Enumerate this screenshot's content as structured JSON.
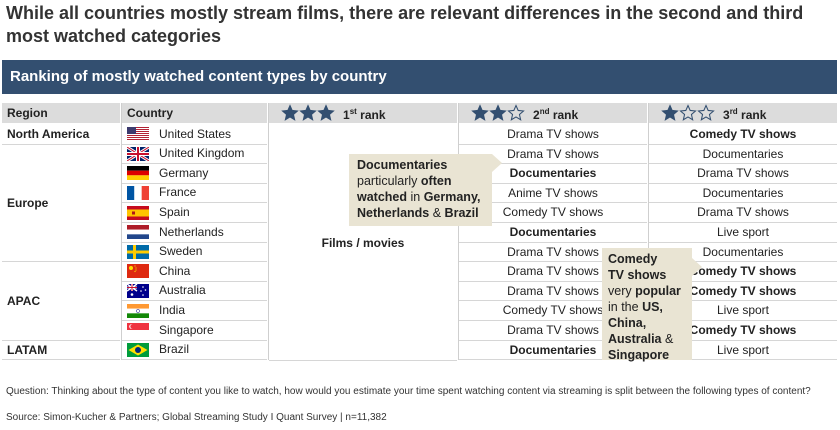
{
  "headline": "While all countries mostly stream films, there are relevant differences in the second and third most watched categories",
  "banner": "Ranking of mostly watched content types by country",
  "headers": {
    "region": "Region",
    "country": "Country",
    "rank1": "1",
    "rank1_suffix": "st",
    "rank2": "2",
    "rank2_suffix": "nd",
    "rank3": "3",
    "rank3_suffix": "rd",
    "rank_word": "rank"
  },
  "colors": {
    "banner": "#334f70",
    "star": "#334f70",
    "callout": "#e9e4d3",
    "header_bg": "#dcdcdc"
  },
  "chart_data": {
    "type": "table",
    "title": "Ranking of mostly watched content types by country",
    "first_rank_all": "Films / movies",
    "regions": [
      {
        "name": "North America",
        "countries": [
          "United States"
        ]
      },
      {
        "name": "Europe",
        "countries": [
          "United Kingdom",
          "Germany",
          "France",
          "Spain",
          "Netherlands",
          "Sweden"
        ]
      },
      {
        "name": "APAC",
        "countries": [
          "China",
          "Australia",
          "India",
          "Singapore"
        ]
      },
      {
        "name": "LATAM",
        "countries": [
          "Brazil"
        ]
      }
    ],
    "rows": [
      {
        "country": "United States",
        "flag": "us",
        "rank2": "Drama TV shows",
        "rank3": "Comedy TV shows",
        "bold2": false,
        "bold3": true
      },
      {
        "country": "United Kingdom",
        "flag": "uk",
        "rank2": "Drama TV shows",
        "rank3": "Documentaries",
        "bold2": false,
        "bold3": false
      },
      {
        "country": "Germany",
        "flag": "de",
        "rank2": "Documentaries",
        "rank3": "Drama TV shows",
        "bold2": true,
        "bold3": false
      },
      {
        "country": "France",
        "flag": "fr",
        "rank2": "Anime TV shows",
        "rank3": "Documentaries",
        "bold2": false,
        "bold3": false
      },
      {
        "country": "Spain",
        "flag": "es",
        "rank2": "Comedy TV shows",
        "rank3": "Drama TV shows",
        "bold2": false,
        "bold3": false
      },
      {
        "country": "Netherlands",
        "flag": "nl",
        "rank2": "Documentaries",
        "rank3": "Live sport",
        "bold2": true,
        "bold3": false
      },
      {
        "country": "Sweden",
        "flag": "se",
        "rank2": "Drama TV shows",
        "rank3": "Documentaries",
        "bold2": false,
        "bold3": false
      },
      {
        "country": "China",
        "flag": "cn",
        "rank2": "Drama TV shows",
        "rank3": "Comedy TV shows",
        "bold2": false,
        "bold3": true
      },
      {
        "country": "Australia",
        "flag": "au",
        "rank2": "Drama TV shows",
        "rank3": "Comedy TV shows",
        "bold2": false,
        "bold3": true
      },
      {
        "country": "India",
        "flag": "in",
        "rank2": "Comedy TV shows",
        "rank3": "Live sport",
        "bold2": false,
        "bold3": false
      },
      {
        "country": "Singapore",
        "flag": "sg",
        "rank2": "Drama TV shows",
        "rank3": "Comedy TV shows",
        "bold2": false,
        "bold3": true
      },
      {
        "country": "Brazil",
        "flag": "br",
        "rank2": "Documentaries",
        "rank3": "Live sport",
        "bold2": true,
        "bold3": false
      }
    ]
  },
  "callouts": {
    "documentaries": {
      "line1": "Documentaries",
      "line2a": "particularly ",
      "line2b": "often",
      "line3a": "watched",
      "line3b": " in ",
      "line3c": "Germany,",
      "line4a": "Netherlands",
      "line4b": " & ",
      "line4c": "Brazil"
    },
    "comedy": {
      "line1": "Comedy",
      "line2": "TV shows",
      "line3a": "very ",
      "line3b": "popular",
      "line4a": "in the ",
      "line4b": "US,",
      "line5": "China,",
      "line6a": "Australia",
      "line6b": " &",
      "line7": "Singapore"
    }
  },
  "footnote": {
    "question": "Question: Thinking about the type of content you like to watch, how would you estimate your time spent watching content via streaming is split between the following types of content?",
    "source": "Source: Simon-Kucher & Partners; Global Streaming Study I Quant Survey  |  n=11,382"
  }
}
